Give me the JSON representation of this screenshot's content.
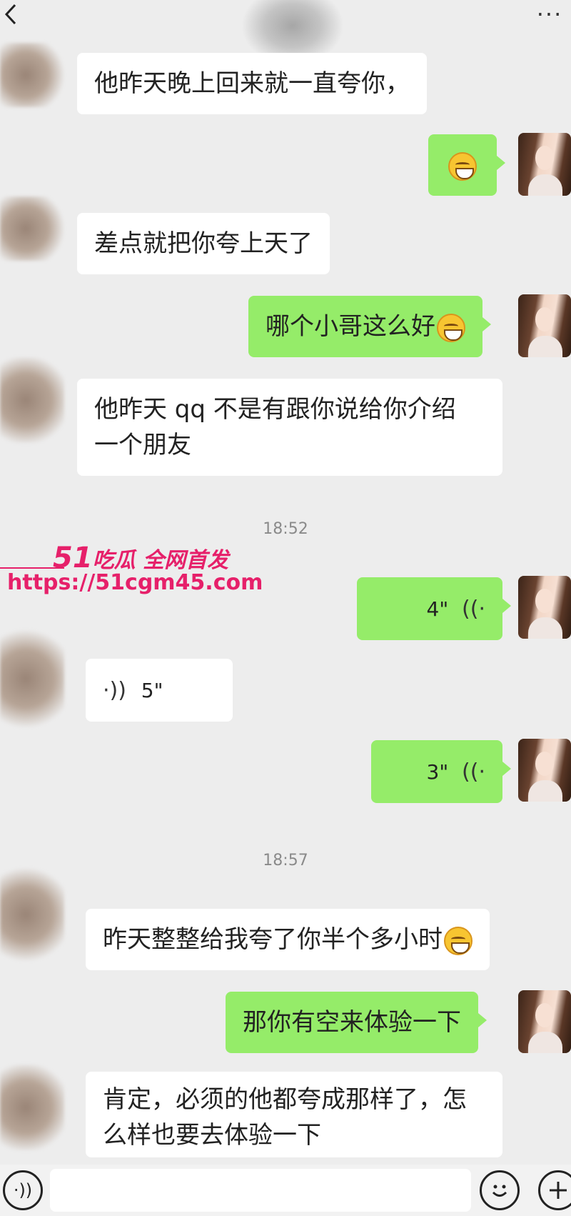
{
  "header": {
    "back_icon": "chevron-left-icon",
    "more_label": "···"
  },
  "messages": [
    {
      "from": "other",
      "text": "他昨天晚上回来就一直夸你，"
    },
    {
      "from": "me",
      "emoji": "grin-emoji"
    },
    {
      "from": "other",
      "text": "差点就把你夸上天了"
    },
    {
      "from": "me",
      "text": "哪个小哥这么好",
      "emoji": "yawn-emoji"
    },
    {
      "from": "other",
      "lines": [
        "他昨天 qq 不是有跟你说给你介绍",
        "一个朋友"
      ]
    },
    {
      "from": "time",
      "text": "18:52"
    },
    {
      "from": "me",
      "voice": "4\""
    },
    {
      "from": "other",
      "voice": "5\""
    },
    {
      "from": "me",
      "voice": "3\""
    },
    {
      "from": "time",
      "text": "18:57"
    },
    {
      "from": "other",
      "text": "昨天整整给我夸了你半个多小时",
      "emoji": "grin-emoji"
    },
    {
      "from": "me",
      "text": "那你有空来体验一下"
    },
    {
      "from": "other",
      "lines": [
        "肯定，必须的他都夸成那样了，怎",
        "么样也要去体验一下"
      ]
    }
  ],
  "watermark": {
    "brand_num": "51",
    "brand_text": "吃瓜 全网首发",
    "url": "https://51cgm45.com"
  },
  "colors": {
    "outgoing": "#95ec69",
    "incoming": "#ffffff",
    "background": "#ededed",
    "watermark": "#e6206a"
  }
}
